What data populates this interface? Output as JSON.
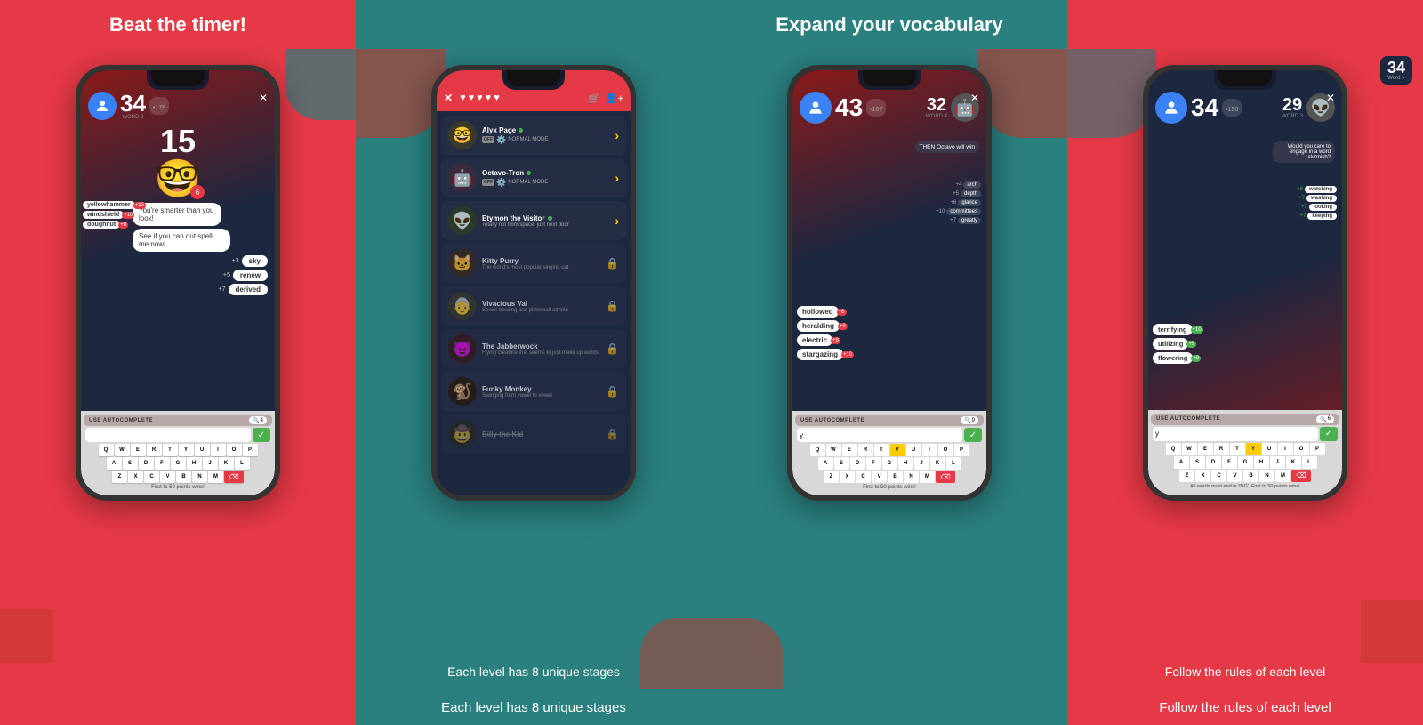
{
  "sections": [
    {
      "id": "section1",
      "banner": {
        "text": "Beat the timer!",
        "bg": "red"
      },
      "caption": "Beat the timer!",
      "phone": {
        "player_score": "34",
        "word_label": "WORD 3",
        "points_badge": "•178",
        "timer": "15",
        "opponent_badge": "6",
        "chat_bubbles": [
          "You're smarter than you look!",
          "See if you can out spell me now!"
        ],
        "right_words": [
          {
            "word": "sky",
            "pts": "+3"
          },
          {
            "word": "renew",
            "pts": "+5"
          },
          {
            "word": "derived",
            "pts": "+7"
          }
        ],
        "left_words": [
          {
            "word": "yellowhammer",
            "pts": "+12"
          },
          {
            "word": "windshield",
            "pts": "+10"
          },
          {
            "word": "doughnut",
            "pts": "+8"
          }
        ],
        "autocomplete_label": "USE AUTOCOMPLETE",
        "autocomplete_count": "4",
        "input_value": "",
        "keyboard_rows": [
          [
            "Q",
            "W",
            "E",
            "R",
            "T",
            "Y",
            "U",
            "I",
            "O",
            "P"
          ],
          [
            "A",
            "S",
            "D",
            "F",
            "G",
            "H",
            "J",
            "K",
            "L"
          ],
          [
            "Z",
            "X",
            "C",
            "V",
            "B",
            "N",
            "M",
            "⌫"
          ]
        ],
        "footer": "First to 50 points wins!"
      }
    },
    {
      "id": "section2",
      "banner": {
        "text": "Each level has 8 unique stages",
        "bg": "teal"
      },
      "caption": "Each level has 8 unique stages",
      "phone": {
        "opponents": [
          {
            "name": "Alyx Page",
            "online": true,
            "mode": "NORMAL MODE",
            "avatar": "🤓",
            "arrow": true
          },
          {
            "name": "Octavo-Tron",
            "online": true,
            "mode": "NORMAL MODE",
            "avatar": "🤖",
            "arrow": true
          },
          {
            "name": "Etymon the Visitor",
            "desc": "Totally not from space, just next door",
            "online": true,
            "avatar": "👽",
            "arrow": true
          },
          {
            "name": "Kitty Purry",
            "desc": "The world's most popular singing cat",
            "avatar": "🐱",
            "locked": true
          },
          {
            "name": "Vivacious Val",
            "desc": "Senior bowling and pickleball athlete",
            "avatar": "👵",
            "locked": true
          },
          {
            "name": "The Jabberwock",
            "desc": "Flying creature that seems to just make up words",
            "avatar": "😈",
            "locked": true
          },
          {
            "name": "Funky Monkey",
            "desc": "Swinging from vowel to vowel",
            "avatar": "🐒",
            "locked": true
          },
          {
            "name": "Billy the Kid",
            "desc": "",
            "avatar": "🤠",
            "locked": true,
            "strikethrough": true
          }
        ]
      }
    },
    {
      "id": "section3",
      "banner": {
        "text": "Expand your vocabulary",
        "bg": "teal"
      },
      "caption": "Expand your vocabulary",
      "phone": {
        "player_score": "43",
        "opp_score": "32",
        "word_label": "WORD 4",
        "points_badge": "•107",
        "opp_bubble": "THEN Octavo will win",
        "opp_words": [
          {
            "pts": "+4",
            "word": "arch"
          },
          {
            "pts": "+5",
            "word": "depth"
          },
          {
            "pts": "+6",
            "word": "glance"
          },
          {
            "pts": "+10",
            "word": "committees"
          },
          {
            "pts": "+7",
            "word": "greatly"
          }
        ],
        "left_words": [
          {
            "word": "hollowed",
            "pts": "+8"
          },
          {
            "word": "heralding",
            "pts": "+9"
          },
          {
            "word": "electric",
            "pts": "+8"
          },
          {
            "word": "stargazing",
            "pts": "+10"
          }
        ],
        "autocomplete_label": "USE AUTOCOMPLETE",
        "autocomplete_count": "9",
        "input_value": "y",
        "keyboard_rows": [
          [
            "Q",
            "W",
            "E",
            "R",
            "T",
            "Y",
            "U",
            "I",
            "O",
            "P"
          ],
          [
            "A",
            "S",
            "D",
            "F",
            "G",
            "H",
            "J",
            "K",
            "L"
          ],
          [
            "Z",
            "X",
            "C",
            "V",
            "B",
            "N",
            "M",
            "⌫"
          ]
        ],
        "highlight_key": "Y",
        "footer": "First to 50 points wins!"
      }
    },
    {
      "id": "section4",
      "banner": {
        "text": "Follow the rules of each level",
        "bg": "red"
      },
      "caption": "Follow the rules of each level",
      "phone": {
        "player_score": "34",
        "opp_score": "29",
        "word_label": "WORD 3",
        "points_badge": "•158",
        "opp_bubble": "Would you care to engage in a word skirmish?",
        "right_words": [
          {
            "pts": "+8",
            "word": "watching"
          },
          {
            "pts": "+7",
            "word": "washing"
          },
          {
            "pts": "+7",
            "word": "looking"
          },
          {
            "pts": "+7",
            "word": "keeping"
          }
        ],
        "left_words": [
          {
            "word": "terrifying",
            "pts": "+10"
          },
          {
            "word": "utilizing",
            "pts": "+9"
          },
          {
            "word": "flowering",
            "pts": "+9"
          }
        ],
        "autocomplete_label": "USE AUTOCOMPLETE",
        "autocomplete_count": "6",
        "input_value": "y",
        "keyboard_rows": [
          [
            "Q",
            "W",
            "E",
            "R",
            "T",
            "Y",
            "U",
            "I",
            "O",
            "P"
          ],
          [
            "A",
            "S",
            "D",
            "F",
            "G",
            "H",
            "J",
            "K",
            "L"
          ],
          [
            "Z",
            "X",
            "C",
            "V",
            "B",
            "N",
            "M",
            "⌫"
          ]
        ],
        "highlight_key": "Y",
        "footer": "All words must end in 'ING'. First to 50 points wins!"
      }
    }
  ]
}
